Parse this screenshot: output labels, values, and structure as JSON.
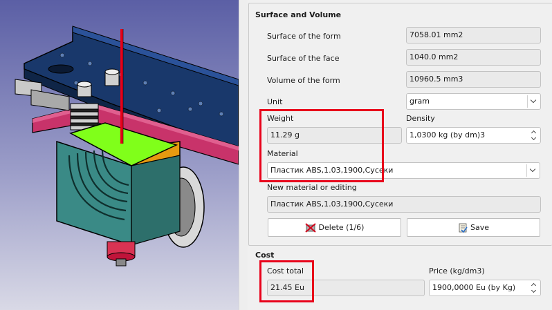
{
  "surface_volume": {
    "title": "Surface and Volume",
    "surface_form_label": "Surface of the form",
    "surface_form_value": "7058.01 mm2",
    "surface_face_label": "Surface of the face",
    "surface_face_value": "1040.0 mm2",
    "volume_label": "Volume of the form",
    "volume_value": "10960.5 mm3",
    "unit_label": "Unit",
    "unit_value": "gram",
    "weight_label": "Weight",
    "weight_value": "11.29 g",
    "density_label": "Density",
    "density_value": "1,0300 kg (by dm)3",
    "material_label": "Material",
    "material_value": "Пластик ABS,1.03,1900,Сусеки",
    "new_material_label": "New material or editing",
    "new_material_value": "Пластик ABS,1.03,1900,Сусеки",
    "delete_label": "Delete (1/6)",
    "save_label": "Save"
  },
  "cost": {
    "title": "Cost",
    "total_label": "Cost total",
    "total_value": "21.45 Eu",
    "price_label": "Price (kg/dm3)",
    "price_value": "1900,0000 Eu (by Kg)"
  },
  "icons": {
    "delete": "delete-icon",
    "save": "save-icon"
  },
  "colors": {
    "highlight": "#e8001a",
    "viewport_top": "#5b5fa5",
    "viewport_bottom": "#d9d9e6",
    "selected_face": "#80ff1a"
  }
}
